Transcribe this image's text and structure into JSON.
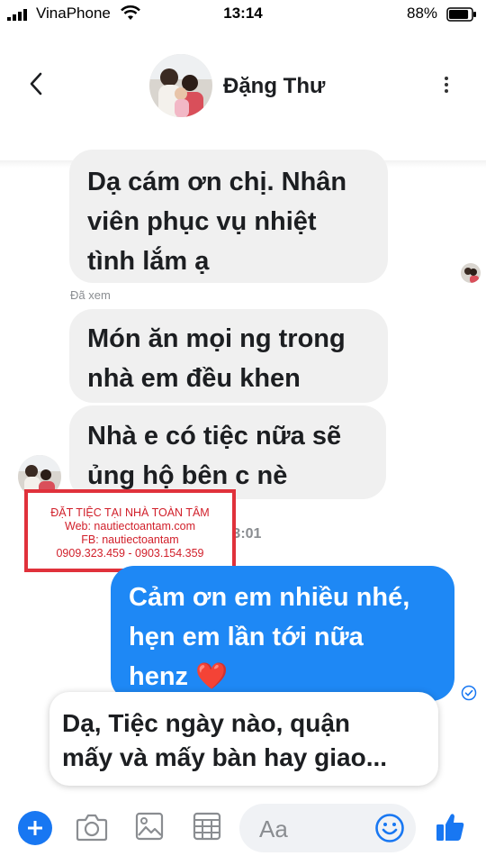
{
  "status_bar": {
    "carrier": "VinaPhone",
    "time": "13:14",
    "battery": "88%",
    "battery_level": 0.88
  },
  "header": {
    "contact_name": "Đặng Thư",
    "back_icon": "chevron-left-icon",
    "more_icon": "more-vertical-icon"
  },
  "messages": {
    "incoming_1": [
      "Dạ cám ơn chị. Nhân",
      "viên phục vụ nhiệt",
      "tình lắm ạ"
    ],
    "seen_label": "Đã xem",
    "incoming_2": [
      "Món ăn mọi ng trong",
      "nhà em đều khen"
    ],
    "incoming_3": [
      "Nhà e có tiệc nữa sẽ",
      "ủng hộ bên c nè"
    ],
    "timestamp": "13:01",
    "outgoing_1": [
      "Cảm ơn em nhiều nhé,",
      "hẹn em lần tới nữa",
      "henz ❤️"
    ]
  },
  "watermark": {
    "line1": "ĐẶT TIỆC TẠI NHÀ TOÀN TÂM",
    "line2": "Web: nautiectoantam.com",
    "line3": "FB: nautiectoantam",
    "line4": "0909.323.459 - 0903.154.359"
  },
  "suggestion": {
    "lines": [
      "Dạ, Tiệc ngày nào, quận",
      "mấy và mấy bàn hay giao..."
    ]
  },
  "composer": {
    "placeholder": "Aa",
    "icons": [
      "plus-icon",
      "camera-icon",
      "photo-icon",
      "grid-icon",
      "emoji-icon",
      "thumbs-up-icon"
    ]
  },
  "colors": {
    "accent": "#1877f2",
    "outgoing_bubble": "#1e88f5",
    "incoming_bubble": "#f0f0f0",
    "watermark_red": "#e0313b"
  }
}
